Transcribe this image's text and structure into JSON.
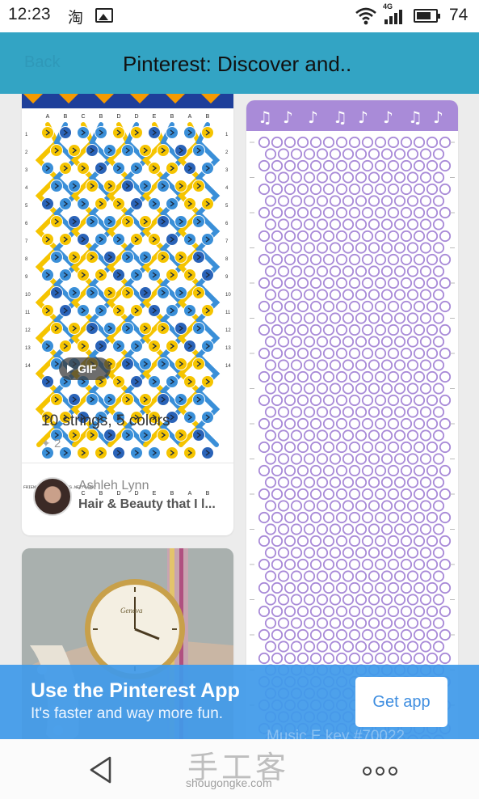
{
  "status_bar": {
    "time": "12:23",
    "notification_glyph": "淘",
    "network_type": "4G",
    "battery_percent": "74",
    "battery_level": 0.74,
    "icons": [
      "gallery-icon",
      "wifi-icon",
      "signal-icon",
      "battery-icon"
    ]
  },
  "header": {
    "back_label": "Back",
    "title": "Pinterest: Discover and.."
  },
  "pins": [
    {
      "type": "gif",
      "badge": "GIF",
      "title": "10 strings, 5 colors",
      "repin_count": "2",
      "pinner": "Ashleh Lynn",
      "board": "Hair & Beauty that I l...",
      "pattern_columns": [
        "A",
        "B",
        "C",
        "B",
        "D",
        "D",
        "E",
        "B",
        "A",
        "B"
      ],
      "pattern_rows": [
        "1",
        "2",
        "3",
        "4",
        "5",
        "6",
        "7",
        "8",
        "9",
        "10",
        "11",
        "12",
        "13",
        "14"
      ],
      "pattern_colors": [
        "#f5c400",
        "#3a8fd8",
        "#2a63b8",
        "#1e4f7a",
        "#f59a00"
      ],
      "pattern_credit": "FRIENDSHIP-BRACELETS.NET/44497"
    },
    {
      "type": "image",
      "subject": "friendship bracelet pattern with music notes",
      "pattern_colors": [
        "#a98bd8",
        "#ffffff"
      ]
    },
    {
      "type": "image",
      "subject": "wrist watch with braided bracelet",
      "watch_brand": "Geneva"
    }
  ],
  "banner": {
    "title": "Use the Pinterest App",
    "subtitle": "It's faster and way more fun.",
    "button": "Get app",
    "behind_text": "Music E key #70022"
  },
  "nav": {
    "icons": [
      "back-triangle-icon",
      "more-dots-icon"
    ]
  },
  "watermark": {
    "glyphs": "手工客",
    "domain": "shougongke.com"
  }
}
